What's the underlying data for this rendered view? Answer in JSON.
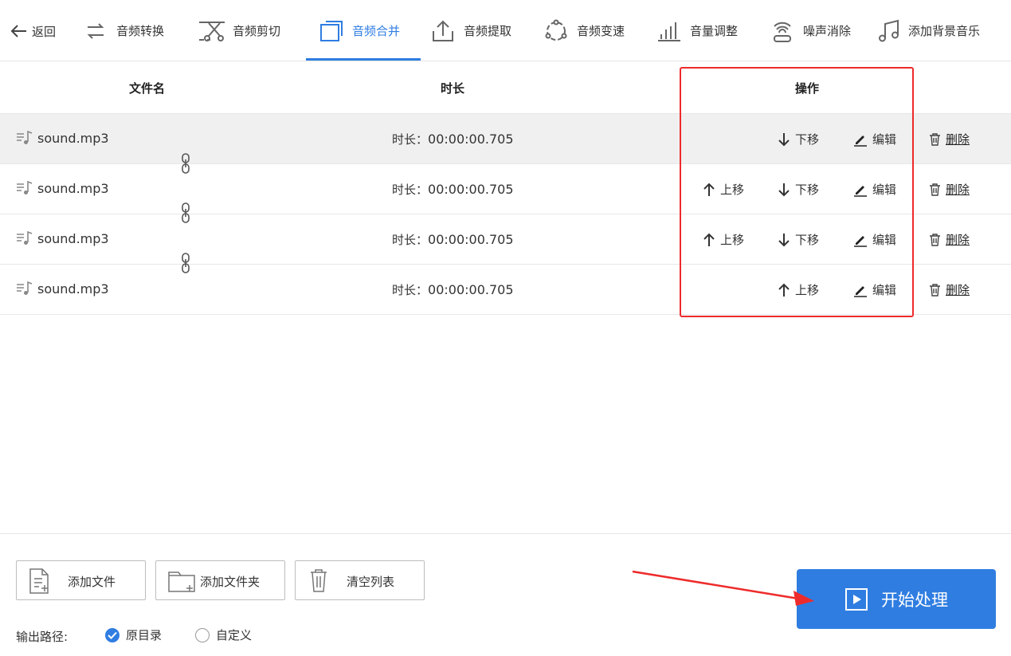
{
  "nav": {
    "back_label": "返回",
    "items": [
      {
        "label": "音频转换",
        "icon": "convert-arrows-icon"
      },
      {
        "label": "音频剪切",
        "icon": "scissors-icon"
      },
      {
        "label": "音频合并",
        "icon": "merge-icon",
        "active": true
      },
      {
        "label": "音频提取",
        "icon": "upload-extract-icon"
      },
      {
        "label": "音频变速",
        "icon": "speed-circle-icon"
      },
      {
        "label": "音量调整",
        "icon": "volume-bars-icon"
      },
      {
        "label": "噪声消除",
        "icon": "noise-wave-icon"
      },
      {
        "label": "添加背景音乐",
        "icon": "music-note-icon"
      }
    ],
    "accent_color": "#2f7de1"
  },
  "table": {
    "headers": {
      "filename": "文件名",
      "duration": "时长",
      "actions": "操作"
    },
    "rows": [
      {
        "filename": "sound.mp3",
        "duration_label": "时长：",
        "duration": "00:00:00.705"
      },
      {
        "filename": "sound.mp3",
        "duration_label": "时长：",
        "duration": "00:00:00.705"
      },
      {
        "filename": "sound.mp3",
        "duration_label": "时长：",
        "duration": "00:00:00.705"
      },
      {
        "filename": "sound.mp3",
        "duration_label": "时长：",
        "duration": "00:00:00.705"
      }
    ],
    "actions": {
      "up": "上移",
      "down": "下移",
      "edit": "编辑",
      "delete": "删除"
    }
  },
  "bottom": {
    "add_file": "添加文件",
    "add_folder": "添加文件夹",
    "clear_list": "清空列表",
    "output_label": "输出路径:",
    "radio_original": "原目录",
    "radio_custom": "自定义",
    "start": "开始处理"
  },
  "annotation_color": "#ee2b2b"
}
